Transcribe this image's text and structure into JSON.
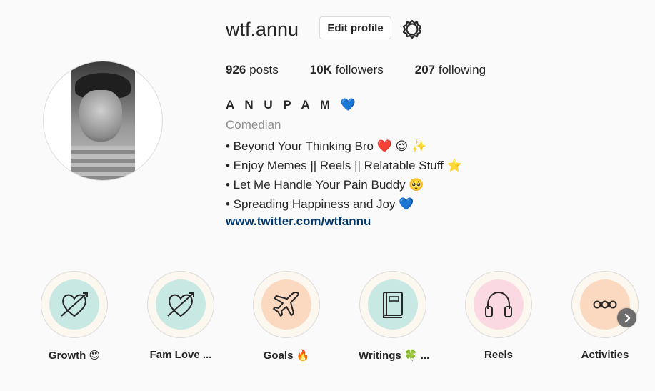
{
  "profile": {
    "username": "wtf.annu",
    "edit_label": "Edit profile",
    "stats": [
      {
        "count": "926",
        "label": "posts"
      },
      {
        "count": "10K",
        "label": "followers"
      },
      {
        "count": "207",
        "label": "following"
      }
    ],
    "full_name": "A N U P A M 💙",
    "category": "Comedian",
    "bio": [
      "• Beyond Your Thinking Bro ❤️ 😌 ✨",
      "• Enjoy Memes || Reels || Relatable Stuff ⭐",
      "• Let Me Handle Your Pain Buddy 🥺",
      "• Spreading Happiness and Joy 💙"
    ],
    "link": "www.twitter.com/wtfannu"
  },
  "highlights": [
    {
      "label": "Growth 😍",
      "icon": "heart-arrow-icon",
      "bg": "#c8e8e4"
    },
    {
      "label": "Fam Love ...",
      "icon": "heart-arrow-icon",
      "bg": "#c8e8e4"
    },
    {
      "label": "Goals 🔥",
      "icon": "airplane-icon",
      "bg": "#fbd9c0"
    },
    {
      "label": "Writings 🍀 ...",
      "icon": "book-icon",
      "bg": "#c8e8e4"
    },
    {
      "label": "Reels",
      "icon": "headphones-icon",
      "bg": "#fbd9e2"
    },
    {
      "label": "Activities",
      "icon": "more-dots-icon",
      "bg": "#fbd9c0"
    }
  ],
  "colors": {
    "link": "#00376b",
    "muted": "#8e8e8e",
    "border": "#dbdbdb"
  }
}
